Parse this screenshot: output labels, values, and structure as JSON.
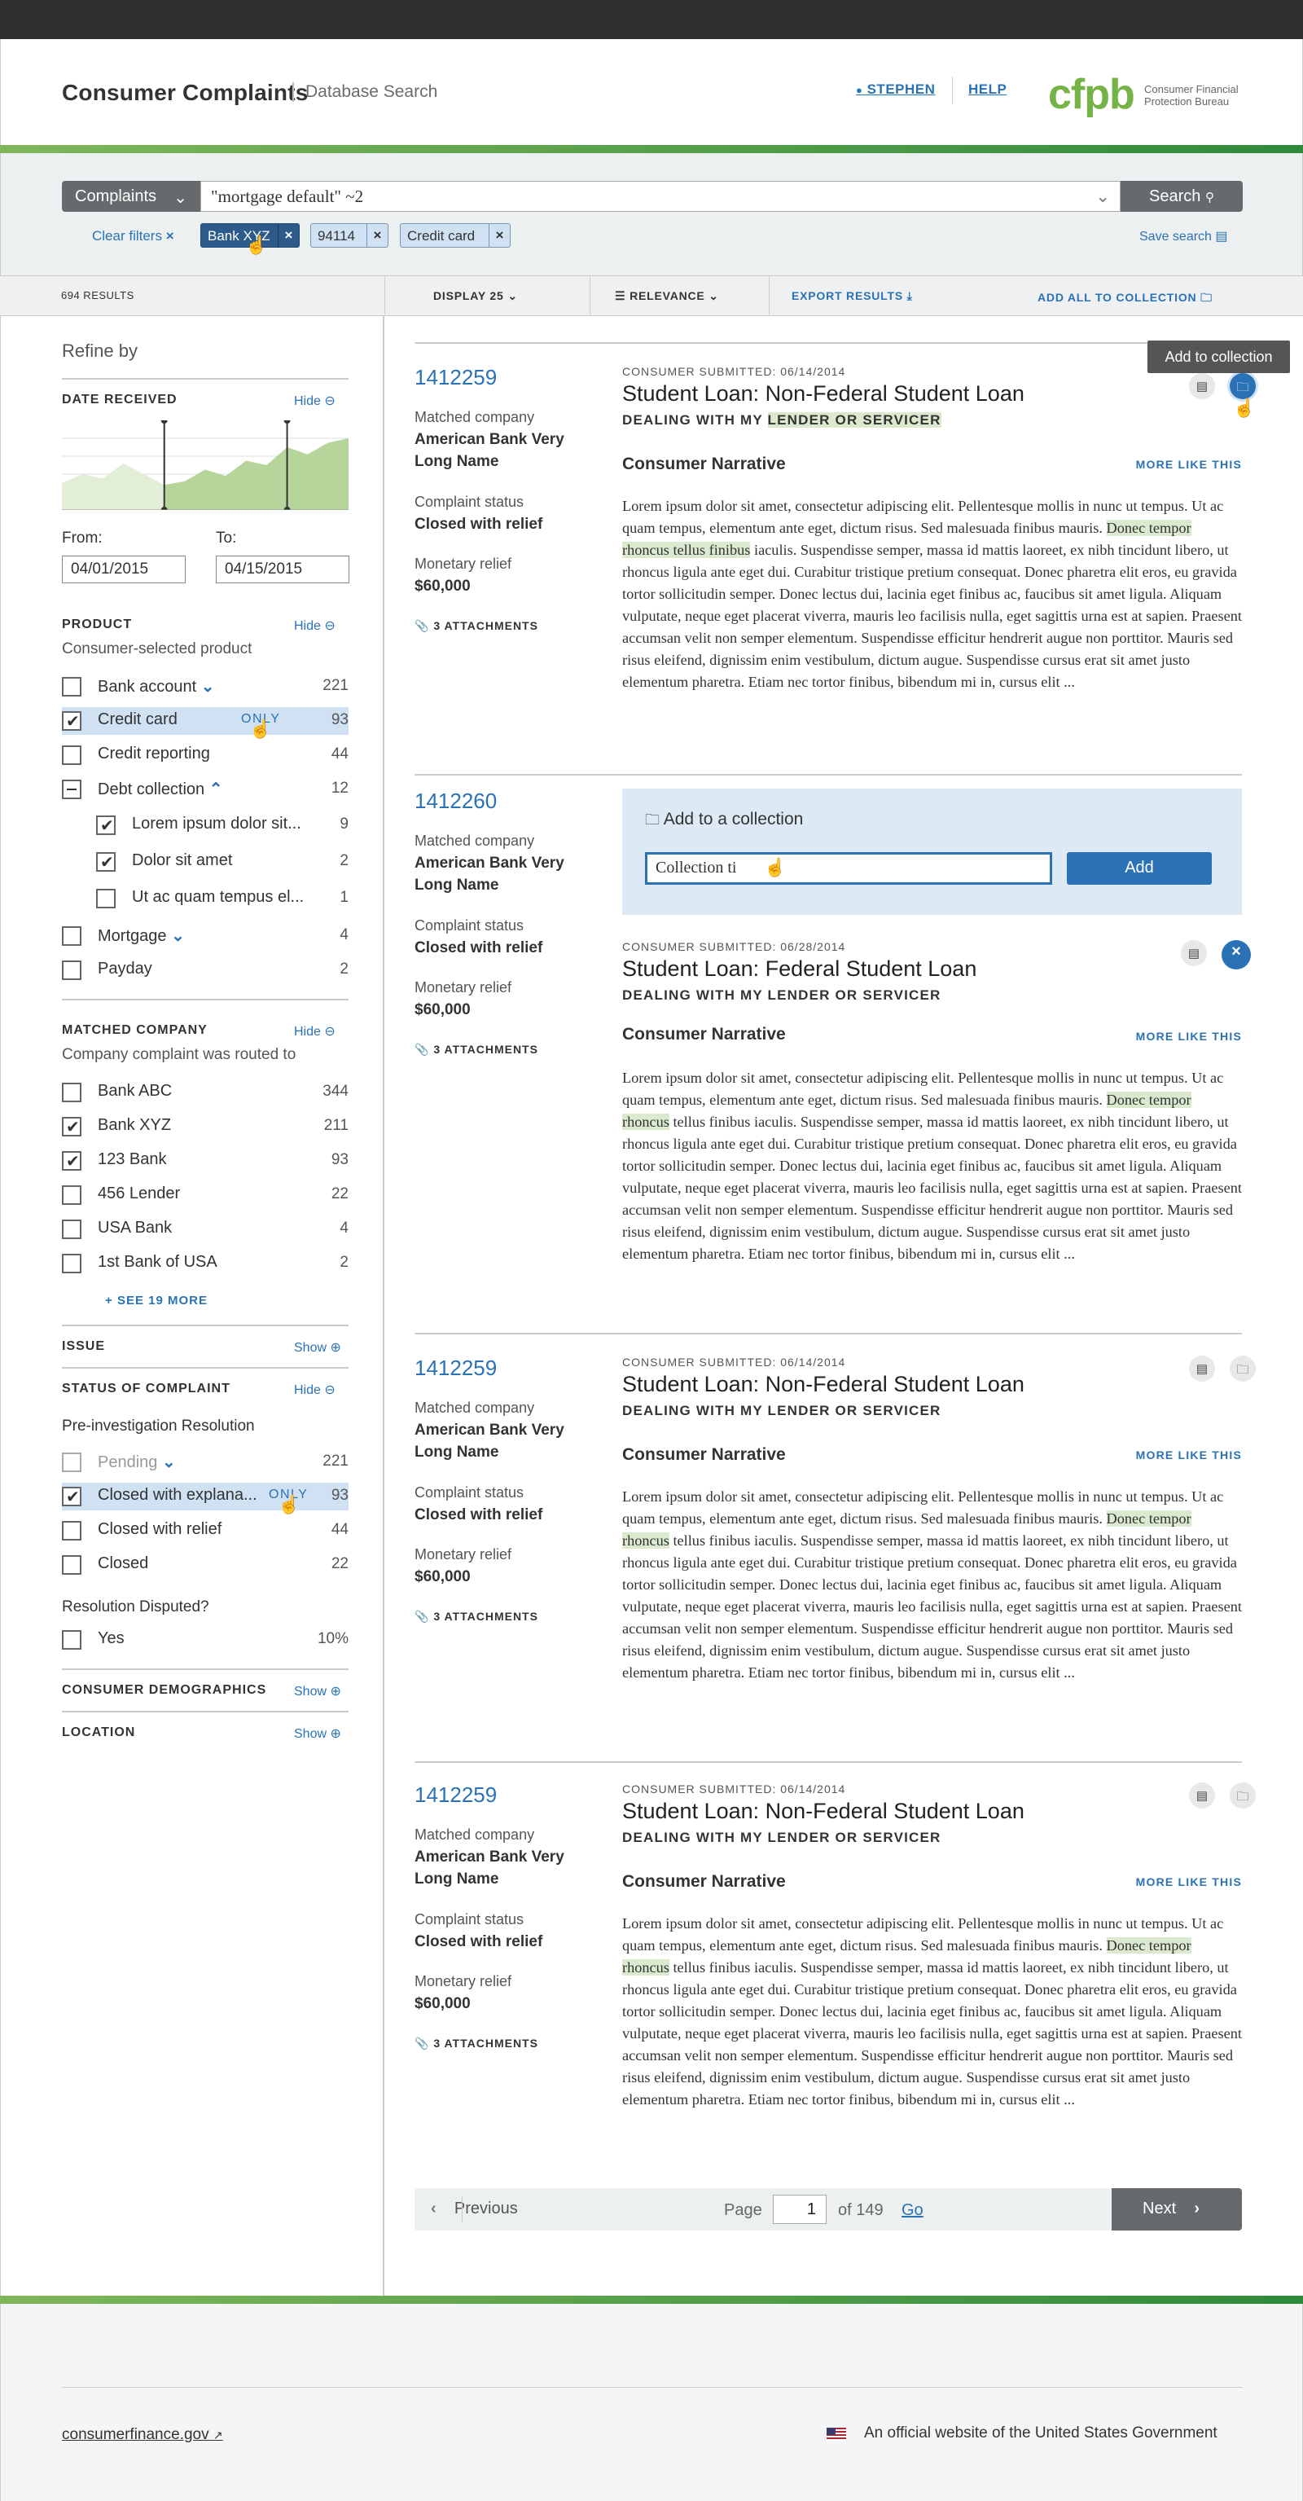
{
  "header": {
    "app_title": "Consumer Complaints",
    "app_subtitle": "Database Search",
    "user_link": "STEPHEN",
    "help_link": "HELP",
    "logo_mark": "cfpb",
    "logo_text_1": "Consumer Financial",
    "logo_text_2": "Protection Bureau"
  },
  "search": {
    "type": "Complaints",
    "query": "\"mortgage default\" ~2",
    "button": "Search",
    "clear_filters": "Clear filters",
    "chips": [
      "Bank XYZ",
      "94114",
      "Credit card"
    ],
    "save_search": "Save search"
  },
  "toolbar": {
    "results": "694 RESULTS",
    "display": "DISPLAY 25",
    "relevance": "RELEVANCE",
    "export": "EXPORT RESULTS",
    "add_all": "ADD ALL TO COLLECTION"
  },
  "sidebar": {
    "refine": "Refine by",
    "hide": "Hide",
    "show": "Show",
    "only": "ONLY",
    "date": {
      "heading": "DATE RECEIVED",
      "from_label": "From:",
      "to_label": "To:",
      "from": "04/01/2015",
      "to": "04/15/2015"
    },
    "product": {
      "heading": "PRODUCT",
      "sub": "Consumer-selected product",
      "items": [
        {
          "label": "Bank account",
          "count": "221"
        },
        {
          "label": "Credit card",
          "count": "93"
        },
        {
          "label": "Credit reporting",
          "count": "44"
        },
        {
          "label": "Debt collection",
          "count": "12"
        },
        {
          "label": "Lorem ipsum dolor sit...",
          "count": "9"
        },
        {
          "label": "Dolor sit amet",
          "count": "2"
        },
        {
          "label": "Ut ac quam tempus el...",
          "count": "1"
        },
        {
          "label": "Mortgage",
          "count": "4"
        },
        {
          "label": "Payday",
          "count": "2"
        }
      ]
    },
    "company": {
      "heading": "MATCHED COMPANY",
      "sub": "Company complaint was routed to",
      "items": [
        {
          "label": "Bank ABC",
          "count": "344"
        },
        {
          "label": "Bank XYZ",
          "count": "211"
        },
        {
          "label": "123 Bank",
          "count": "93"
        },
        {
          "label": "456 Lender",
          "count": "22"
        },
        {
          "label": "USA Bank",
          "count": "4"
        },
        {
          "label": "1st Bank of USA",
          "count": "2"
        }
      ],
      "see_more": "SEE 19 MORE"
    },
    "issue": {
      "heading": "ISSUE"
    },
    "status": {
      "heading": "STATUS OF COMPLAINT",
      "sub": "Pre-investigation Resolution",
      "items": [
        {
          "label": "Pending",
          "count": "221"
        },
        {
          "label": "Closed with explana...",
          "count": "93"
        },
        {
          "label": "Closed with relief",
          "count": "44"
        },
        {
          "label": "Closed",
          "count": "22"
        }
      ],
      "disputed": "Resolution Disputed?",
      "yes": {
        "label": "Yes",
        "count": "10%"
      }
    },
    "demographics": {
      "heading": "CONSUMER DEMOGRAPHICS"
    },
    "location": {
      "heading": "LOCATION"
    }
  },
  "labels": {
    "matched_company": "Matched company",
    "complaint_status": "Complaint status",
    "monetary_relief": "Monetary relief",
    "attachments": "3 ATTACHMENTS",
    "submitted": "CONSUMER SUBMITTED:",
    "narrative": "Consumer Narrative",
    "more_like_this": "MORE LIKE THIS",
    "tooltip": "Add to collection",
    "add_collection": "Add to a collection",
    "collection_input": "Collection ti",
    "add_button": "Add"
  },
  "narrative": {
    "before": "Lorem ipsum dolor sit amet, consectetur adipiscing elit. Pellentesque mollis in nunc ut tempus. Ut ac quam tempus, elementum ante eget, dictum risus. Sed malesuada finibus mauris. ",
    "after": " iaculis. Suspendisse semper, massa id mattis laoreet, ex nibh tincidunt libero, ut rhoncus ligula ante eget dui. Curabitur tristique pretium consequat. Donec pharetra elit eros, eu gravida tortor sollicitudin semper. Donec lectus dui, lacinia eget finibus ac, faucibus sit amet ligula. Aliquam vulputate, neque eget placerat viverra, mauris leo facilisis nulla, eget sagittis urna est at sapien. Praesent accumsan velit non semper elementum. Suspendisse efficitur hendrerit augue non porttitor. Mauris sed risus eleifend, dignissim enim vestibulum, dictum augue. Suspendisse cursus erat sit amet justo elementum pharetra. Etiam nec tortor finibus, bibendum mi in, cursus elit ..."
  },
  "results": [
    {
      "id": "1412259",
      "date": "06/14/2014",
      "title": "Student Loan: Non-Federal Student Loan",
      "issue_a": "DEALING WITH MY ",
      "issue_b": "LENDER OR SERVICER",
      "company": "American Bank Very Long Name",
      "status": "Closed with relief",
      "relief": "$60,000",
      "hl_a": "Donec tempor rhoncus tellus finibus",
      "hl_b": ""
    },
    {
      "id": "1412260",
      "date": "06/28/2014",
      "title": "Student Loan: Federal Student Loan",
      "issue_a": "DEALING WITH MY LENDER OR SERVICER",
      "issue_b": "",
      "company": "American Bank Very Long Name",
      "status": "Closed with relief",
      "relief": "$60,000",
      "hl_a": "Donec tempor rhoncus",
      "hl_b": " tellus finibus"
    },
    {
      "id": "1412259",
      "date": "06/14/2014",
      "title": "Student Loan: Non-Federal Student Loan",
      "issue_a": "DEALING WITH MY LENDER OR SERVICER",
      "issue_b": "",
      "company": "American Bank Very Long Name",
      "status": "Closed with relief",
      "relief": "$60,000",
      "hl_a": "Donec tempor rhoncus",
      "hl_b": " tellus finibus"
    },
    {
      "id": "1412259",
      "date": "06/14/2014",
      "title": "Student Loan: Non-Federal Student Loan",
      "issue_a": "DEALING WITH MY LENDER OR SERVICER",
      "issue_b": "",
      "company": "American Bank Very Long Name",
      "status": "Closed with relief",
      "relief": "$60,000",
      "hl_a": "Donec tempor rhoncus",
      "hl_b": " tellus finibus"
    }
  ],
  "pager": {
    "previous": "Previous",
    "page_label": "Page",
    "page": "1",
    "of": "of 149",
    "go": "Go",
    "next": "Next"
  },
  "footer": {
    "link": "consumerfinance.gov",
    "official": "An official website of the United States Government"
  },
  "colors": {
    "accent": "#2a72b5",
    "green": "#75b347",
    "highlight": "#dbe9cf"
  },
  "chart_data": {
    "type": "area",
    "x": [
      0,
      1,
      2,
      3,
      4,
      5,
      6,
      7,
      8,
      9,
      10,
      11,
      12,
      13,
      14
    ],
    "values": [
      30,
      40,
      35,
      52,
      40,
      28,
      32,
      45,
      38,
      55,
      50,
      70,
      62,
      75,
      80
    ],
    "ylim": [
      0,
      100
    ],
    "selected_range": [
      5,
      11
    ]
  }
}
